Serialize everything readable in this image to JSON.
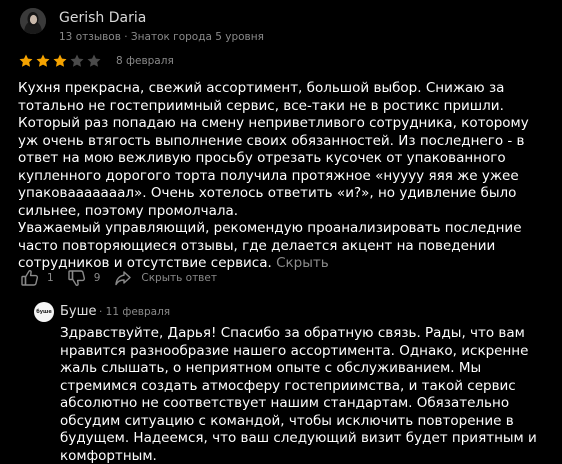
{
  "author": {
    "name": "Gerish Daria",
    "meta": "13 отзывов · Знаток города 5 уровня"
  },
  "review": {
    "rating": 3,
    "rating_max": 5,
    "date": "8 февраля",
    "text": "Кухня прекрасна, свежий ассортимент, большой выбор. Снижаю за тотально не гостеприимный сервис, все-таки не в ростикс пришли. Который раз попадаю на смену неприветливого сотрудника, которому уж очень втягость выполнение своих обязанностей. Из последнего - в ответ на мою вежливую просьбу отрезать кусочек от упакованного купленного дорогого торта получила протяжное «нуууу яяя же ужее упаковааааааал». Очень хотелось ответить «и?», но удивление было сильнее, поэтому промолчала.\nУважаемый управляющий, рекомендую проанализировать последние часто повторяющиеся отзывы, где делается акцент на поведении сотрудников и отсутствие сервиса.",
    "collapse_label": "Скрыть"
  },
  "actions": {
    "likes": "1",
    "dislikes": "9",
    "reply_label": "Скрыть ответ"
  },
  "answer": {
    "logo_text": "буше",
    "org_name": "Буше",
    "date": "· 11 февраля",
    "text": "Здравствуйте, Дарья! Спасибо за обратную связь. Рады, что вам нравится разнообразие нашего ассортимента. Однако, искренне жаль слышать, о неприятном опыте с обслуживанием. Мы стремимся создать атмосферу гостеприимства, и такой сервис абсолютно не соответствует нашим стандартам. Обязательно обсудим ситуацию с командой, чтобы исключить повторение в будущем. Надеемся, что ваш следующий визит будет приятным и комфортным."
  },
  "colors": {
    "star_filled": "#f5a300",
    "star_empty": "#4a4a4a",
    "muted_text": "#8a8a8a"
  }
}
